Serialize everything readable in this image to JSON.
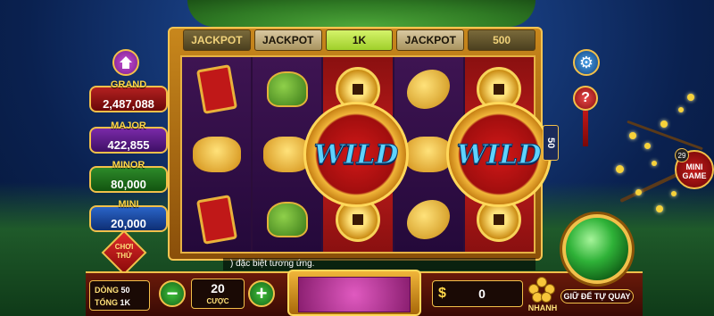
{
  "jackpot_bar": [
    "JACKPOT",
    "JACKPOT",
    "1K",
    "JACKPOT",
    "500"
  ],
  "jackpots": {
    "grand": {
      "label": "GRAND",
      "value": "2,487,088"
    },
    "major": {
      "label": "MAJOR",
      "value": "422,855"
    },
    "minor": {
      "label": "MINOR",
      "value": "80,000"
    },
    "mini": {
      "label": "MINI",
      "value": "20,000"
    }
  },
  "reels": {
    "wild_label": "WILD",
    "symbols_icons": [
      "scroll-icon",
      "frog-icon",
      "ox-icon",
      "coin-icon",
      "fish-icon"
    ]
  },
  "trial_button": "CHƠI THỬ",
  "lines_tab": "50",
  "minigame": {
    "badge": "29",
    "label": "MINI GAME"
  },
  "marquee": ") đặc biệt tương ứng.",
  "info": {
    "lines_key": "DÒNG",
    "lines_val": "50",
    "total_key": "TỔNG",
    "total_val": "1K"
  },
  "bet": {
    "value": "20",
    "label": "CƯỢC",
    "minus": "−",
    "plus": "+"
  },
  "win": {
    "currency": "$",
    "value": "0"
  },
  "fast_label": "NHANH",
  "auto_label": "GIỮ ĐỂ TỰ QUAY",
  "help_label": "?",
  "colors": {
    "gold": "#f2c04a",
    "grand": "#b32020",
    "major": "#7a2aa8",
    "minor": "#2d8a2a",
    "mini": "#2a64c8"
  }
}
